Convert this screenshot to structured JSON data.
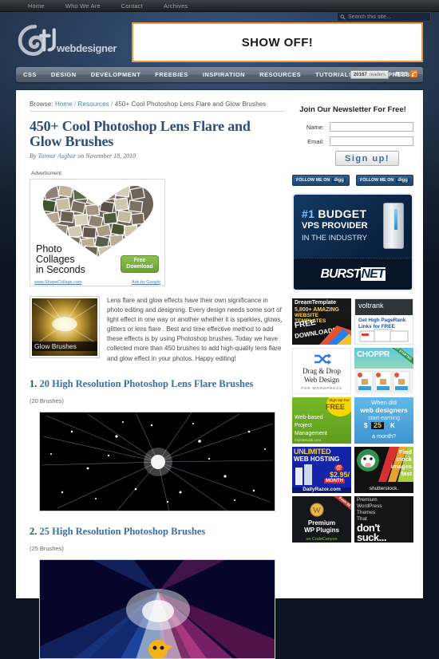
{
  "topbar": {
    "links": [
      "Home",
      "Who We Are",
      "Contact",
      "Archives"
    ]
  },
  "search": {
    "placeholder": "Search this site...",
    "value": "",
    "icon": "search-icon"
  },
  "header": {
    "logo_text": "webdesigner",
    "banner_text": "SHOW OFF!"
  },
  "mainnav": {
    "links": [
      "CSS",
      "DESIGN",
      "DEVELOPMENT",
      "FREEBIES",
      "INSPIRATION",
      "RESOURCES",
      "TUTORIALS",
      "WORDPRESS"
    ],
    "readers_count": "20167",
    "readers_label": "readers",
    "rss_label": "RSS"
  },
  "article": {
    "breadcrumb_prefix": "Browse:",
    "breadcrumb_home": "Home",
    "breadcrumb_section": "Resources",
    "breadcrumb_current": "450+ Cool Photoshop Lens Flare and Glow Brushes",
    "sep": "/",
    "title": "450+ Cool Photoshop Lens Flare and Glow Brushes",
    "byline_by": "By",
    "byline_author": "Taimur Asghar",
    "byline_on": "on",
    "byline_date": "November 18, 2010",
    "advert_label": "Advertisment",
    "intro": "Lens flare and glow effects have their own significance in photo editing and designing. Every design needs some sort of light effect in one way or another whether it is sparkles, glows, glitters or lens flare . Best and time effective method to add these effects is by using Photoshop brushes. Today we have collected more than 450 brushes to add high-quality lens flare and glow effect in your photos. Happy editing!",
    "thumb_caption": "Glow Brushes",
    "sections": [
      {
        "num": "1.",
        "title": "20 High Resolution Photoshop Lens Flare Brushes",
        "count": "(20 Brushes)"
      },
      {
        "num": "2.",
        "title": "25 High Resolution Photoshop Brushes",
        "count": "(25 Brushes)"
      }
    ]
  },
  "google_ad": {
    "line1": "Photo",
    "line2": "Collages",
    "line3": "in Seconds",
    "button_line1": "Free",
    "button_line2": "Download",
    "site": "www.ShapeCollage.com",
    "provider": "Ads by Google"
  },
  "sidebar": {
    "newsletter": {
      "heading": "Join Our Newsletter For Free!",
      "name_label": "Name:",
      "name_value": "",
      "email_label": "Email:",
      "email_value": "",
      "submit_label": "Sign up!"
    },
    "social_buttons": [
      {
        "prefix": "FOLLOW ME ON",
        "network": "digg"
      },
      {
        "prefix": "FOLLOW ME ON",
        "network": "digg"
      }
    ],
    "burstnet": {
      "hash": "#1",
      "line1": "BUDGET",
      "line2": "VPS PROVIDER",
      "line3": "IN THE INDUSTRY",
      "logo_a": "BURST",
      "logo_b": "NET",
      "reg": "®"
    },
    "ads": [
      {
        "id": "dreamtemplate",
        "l1": "DreamTemplate",
        "l2": "5,800+ AMAZING",
        "l3": "WEBSITE TEMPLATES",
        "l4": "FREE",
        "l5": "DOWNLOADS"
      },
      {
        "id": "voltrank",
        "l1": "voltrank",
        "l2": "Get High PageRank",
        "l3": "Links for FREE"
      },
      {
        "id": "dragdrop",
        "l1": "Drag & Drop",
        "l2": "Web Design",
        "l3": "FOR WORDPRESS"
      },
      {
        "id": "choppr",
        "l1": "CHOPPR",
        "l2": "GET STARTED"
      },
      {
        "id": "myintervals",
        "l1": "Sign Up For",
        "l2": "FREE",
        "l3": "Web-based",
        "l4": "Project",
        "l5": "Management",
        "l6": "myintervals.com"
      },
      {
        "id": "webdesigner-earn",
        "l1": "When did",
        "l2": "web designers",
        "l3": "start earning",
        "l4": "$",
        "l5": "25",
        "l6": "K",
        "l7": "a month?"
      },
      {
        "id": "dailyrazor",
        "l1": "UNLIMITED",
        "l2": "WEB HOSTING",
        "l3": "@",
        "l4": "$2.95/",
        "l5": "MONTH",
        "l6": "DailyRazor.com"
      },
      {
        "id": "shutterstock",
        "l1": "Find",
        "l2": "stock",
        "l3": "images",
        "l4": "fast",
        "l5": "shutterstock."
      },
      {
        "id": "codecanyon",
        "l1": "From $2",
        "l2": "Premium",
        "l3": "WP Plugins",
        "l4": "on CodeCanyon"
      },
      {
        "id": "wpthemes",
        "l1": "Premium",
        "l2": "WordPress",
        "l3": "Themes",
        "l4": "That",
        "l5": "don't",
        "l6": "suck..."
      }
    ]
  }
}
